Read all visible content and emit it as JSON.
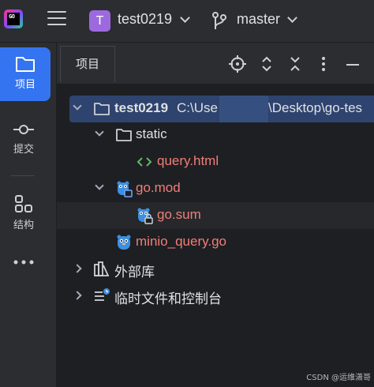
{
  "titlebar": {
    "project_initial": "T",
    "project_name": "test0219",
    "branch_name": "master"
  },
  "left_strip": {
    "items": [
      {
        "label": "项目",
        "icon": "folder-icon",
        "active": true
      },
      {
        "label": "提交",
        "icon": "commit-icon",
        "active": false
      },
      {
        "label": "结构",
        "icon": "structure-icon",
        "active": false
      },
      {
        "label": "",
        "icon": "more-icon",
        "active": false
      }
    ]
  },
  "tool_window": {
    "tab_label": "项目",
    "actions": [
      "locate-icon",
      "expand-all-icon",
      "collapse-all-icon",
      "options-icon",
      "hide-icon"
    ]
  },
  "tree": {
    "root": {
      "name": "test0219",
      "path_prefix": "C:\\Use",
      "path_suffix": "\\Desktop\\go-tes"
    },
    "items": [
      {
        "name": "static",
        "type": "folder"
      },
      {
        "name": "query.html",
        "type": "html"
      },
      {
        "name": "go.mod",
        "type": "gomod"
      },
      {
        "name": "go.sum",
        "type": "gosum"
      },
      {
        "name": "minio_query.go",
        "type": "go"
      },
      {
        "name": "外部库",
        "type": "libraries"
      },
      {
        "name": "临时文件和控制台",
        "type": "scratches"
      }
    ]
  },
  "colors": {
    "accent": "#3574f0",
    "selection": "#2e436e",
    "file_red": "#f07e79",
    "html_green": "#5fb865",
    "gopher_blue": "#3d8fe0",
    "badge_purple": "#9c6ade"
  },
  "watermark": "CSDN @运维潇哥"
}
